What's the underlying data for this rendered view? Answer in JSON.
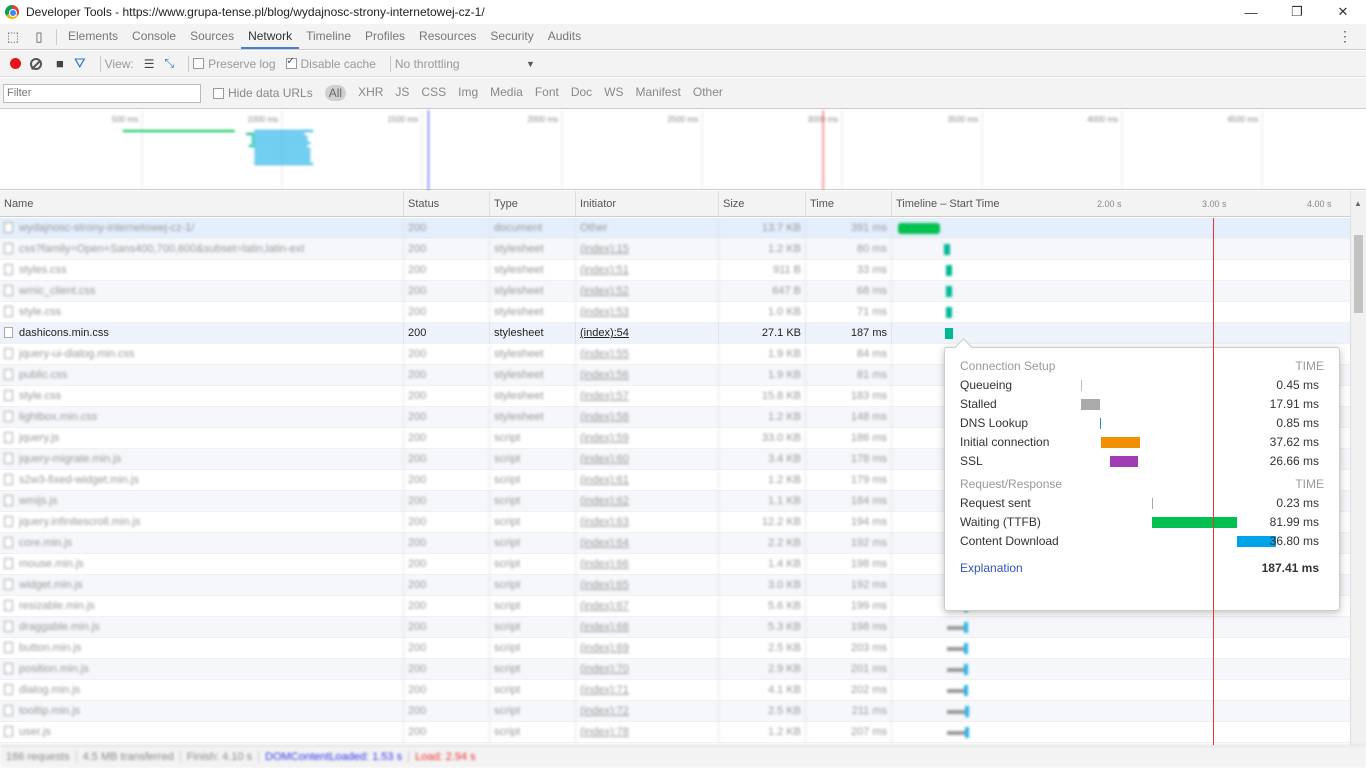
{
  "window": {
    "title": "Developer Tools - https://www.grupa-tense.pl/blog/wydajnosc-strony-internetowej-cz-1/",
    "minimize": "—",
    "restore": "❐",
    "close": "✕"
  },
  "tabs": [
    "Elements",
    "Console",
    "Sources",
    "Network",
    "Timeline",
    "Profiles",
    "Resources",
    "Security",
    "Audits"
  ],
  "active_tab": "Network",
  "toolbar": {
    "view_label": "View:",
    "preserve_log": "Preserve log",
    "disable_cache": "Disable cache",
    "throttling": "No throttling"
  },
  "filter": {
    "placeholder": "Filter",
    "hide_data_urls": "Hide data URLs",
    "types": [
      "All",
      "XHR",
      "JS",
      "CSS",
      "Img",
      "Media",
      "Font",
      "Doc",
      "WS",
      "Manifest",
      "Other"
    ]
  },
  "overview_ticks": [
    "500 ms",
    "1000 ms",
    "1500 ms",
    "2000 ms",
    "2500 ms",
    "3000 ms",
    "3500 ms",
    "4000 ms",
    "4500 ms"
  ],
  "columns": {
    "name": "Name",
    "status": "Status",
    "type": "Type",
    "initiator": "Initiator",
    "size": "Size",
    "time": "Time",
    "timeline": "Timeline – Start Time",
    "t1": "2.00 s",
    "t2": "3.00 s",
    "t3": "4.00 s"
  },
  "rows": [
    {
      "name": "wydajnosc-strony-internetowej-cz-1/",
      "status": "200",
      "type": "document",
      "initiator": "Other",
      "size": "13.7 KB",
      "time": "391 ms",
      "start": 0.01,
      "dur": 0.4
    },
    {
      "name": "css?family=Open+Sans400,700,600&subset=latin,latin-ext",
      "status": "200",
      "type": "stylesheet",
      "initiator": "(index):15",
      "size": "1.2 KB",
      "time": "80 ms",
      "start": 0.45,
      "dur": 0.08
    },
    {
      "name": "styles.css",
      "status": "200",
      "type": "stylesheet",
      "initiator": "(index):51",
      "size": "911 B",
      "time": "33 ms",
      "start": 0.47,
      "dur": 0.04
    },
    {
      "name": "wmic_client.css",
      "status": "200",
      "type": "stylesheet",
      "initiator": "(index):52",
      "size": "647 B",
      "time": "68 ms",
      "start": 0.47,
      "dur": 0.05
    },
    {
      "name": "style.css",
      "status": "200",
      "type": "stylesheet",
      "initiator": "(index):53",
      "size": "1.0 KB",
      "time": "71 ms",
      "start": 0.47,
      "dur": 0.05
    },
    {
      "name": "dashicons.min.css",
      "status": "200",
      "type": "stylesheet",
      "initiator": "(index):54",
      "size": "27.1 KB",
      "time": "187 ms",
      "start": 0.46,
      "dur": 0.19
    },
    {
      "name": "jquery-ui-dialog.min.css",
      "status": "200",
      "type": "stylesheet",
      "initiator": "(index):55",
      "size": "1.9 KB",
      "time": "84 ms",
      "start": 0.48,
      "dur": 0.08
    },
    {
      "name": "public.css",
      "status": "200",
      "type": "stylesheet",
      "initiator": "(index):56",
      "size": "1.9 KB",
      "time": "81 ms",
      "start": 0.48,
      "dur": 0.08
    },
    {
      "name": "style.css",
      "status": "200",
      "type": "stylesheet",
      "initiator": "(index):57",
      "size": "15.8 KB",
      "time": "183 ms",
      "start": 0.48,
      "dur": 0.18
    },
    {
      "name": "lightbox.min.css",
      "status": "200",
      "type": "stylesheet",
      "initiator": "(index):58",
      "size": "1.2 KB",
      "time": "148 ms",
      "start": 0.48,
      "dur": 0.15
    },
    {
      "name": "jquery.js",
      "status": "200",
      "type": "script",
      "initiator": "(index):59",
      "size": "33.0 KB",
      "time": "186 ms",
      "start": 0.48,
      "dur": 0.19
    },
    {
      "name": "jquery-migrate.min.js",
      "status": "200",
      "type": "script",
      "initiator": "(index):60",
      "size": "3.4 KB",
      "time": "178 ms",
      "start": 0.48,
      "dur": 0.18
    },
    {
      "name": "s2w3-fixed-widget.min.js",
      "status": "200",
      "type": "script",
      "initiator": "(index):61",
      "size": "1.2 KB",
      "time": "179 ms",
      "start": 0.48,
      "dur": 0.18
    },
    {
      "name": "wmijs.js",
      "status": "200",
      "type": "script",
      "initiator": "(index):62",
      "size": "1.1 KB",
      "time": "184 ms",
      "start": 0.48,
      "dur": 0.18
    },
    {
      "name": "jquery.infinitescroll.min.js",
      "status": "200",
      "type": "script",
      "initiator": "(index):63",
      "size": "12.2 KB",
      "time": "194 ms",
      "start": 0.48,
      "dur": 0.19
    },
    {
      "name": "core.min.js",
      "status": "200",
      "type": "script",
      "initiator": "(index):64",
      "size": "2.2 KB",
      "time": "192 ms",
      "start": 0.48,
      "dur": 0.19
    },
    {
      "name": "mouse.min.js",
      "status": "200",
      "type": "script",
      "initiator": "(index):66",
      "size": "1.4 KB",
      "time": "198 ms",
      "start": 0.48,
      "dur": 0.2
    },
    {
      "name": "widget.min.js",
      "status": "200",
      "type": "script",
      "initiator": "(index):65",
      "size": "3.0 KB",
      "time": "192 ms",
      "start": 0.48,
      "dur": 0.19
    },
    {
      "name": "resizable.min.js",
      "status": "200",
      "type": "script",
      "initiator": "(index):67",
      "size": "5.6 KB",
      "time": "199 ms",
      "start": 0.48,
      "dur": 0.2
    },
    {
      "name": "draggable.min.js",
      "status": "200",
      "type": "script",
      "initiator": "(index):68",
      "size": "5.3 KB",
      "time": "198 ms",
      "start": 0.48,
      "dur": 0.2
    },
    {
      "name": "button.min.js",
      "status": "200",
      "type": "script",
      "initiator": "(index):69",
      "size": "2.5 KB",
      "time": "203 ms",
      "start": 0.48,
      "dur": 0.2
    },
    {
      "name": "position.min.js",
      "status": "200",
      "type": "script",
      "initiator": "(index):70",
      "size": "2.9 KB",
      "time": "201 ms",
      "start": 0.48,
      "dur": 0.2
    },
    {
      "name": "dialog.min.js",
      "status": "200",
      "type": "script",
      "initiator": "(index):71",
      "size": "4.1 KB",
      "time": "202 ms",
      "start": 0.48,
      "dur": 0.2
    },
    {
      "name": "tooltip.min.js",
      "status": "200",
      "type": "script",
      "initiator": "(index):72",
      "size": "2.5 KB",
      "time": "211 ms",
      "start": 0.48,
      "dur": 0.21
    },
    {
      "name": "user.js",
      "status": "200",
      "type": "script",
      "initiator": "(index):78",
      "size": "1.2 KB",
      "time": "207 ms",
      "start": 0.48,
      "dur": 0.21
    }
  ],
  "timeline_scale_seconds": 4.4,
  "dom_content_loaded_s": 1.53,
  "load_s": 2.94,
  "tooltip": {
    "setup_header": "Connection Setup",
    "time_header": "TIME",
    "setup": [
      {
        "label": "Queueing",
        "value": "0.45 ms",
        "start": 0.0,
        "dur": 0.45,
        "color": "#bbbbbb"
      },
      {
        "label": "Stalled",
        "value": "17.91 ms",
        "start": 0.45,
        "dur": 17.91,
        "color": "#aaaaaa"
      },
      {
        "label": "DNS Lookup",
        "value": "0.85 ms",
        "start": 18.36,
        "dur": 0.85,
        "color": "#1f8ad6"
      },
      {
        "label": "Initial connection",
        "value": "37.62 ms",
        "start": 19.21,
        "dur": 37.62,
        "color": "#f29100"
      },
      {
        "label": "SSL",
        "value": "26.66 ms",
        "start": 28.0,
        "dur": 26.66,
        "color": "#a03cb4"
      }
    ],
    "req_header": "Request/Response",
    "req": [
      {
        "label": "Request sent",
        "value": "0.23 ms",
        "start": 68.12,
        "dur": 0.23,
        "color": "#aaaaaa"
      },
      {
        "label": "Waiting (TTFB)",
        "value": "81.99 ms",
        "start": 68.35,
        "dur": 81.99,
        "color": "#00c050"
      },
      {
        "label": "Content Download",
        "value": "36.80 ms",
        "start": 150.34,
        "dur": 36.8,
        "color": "#00a2e8"
      }
    ],
    "explanation": "Explanation",
    "total": "187.41 ms",
    "total_ms": 187.41
  },
  "status": {
    "requests": "186 requests",
    "transferred": "4.5 MB transferred",
    "finish": "Finish: 4.10 s",
    "dcl": "DOMContentLoaded: 1.53 s",
    "load": "Load: 2.94 s"
  },
  "colors": {
    "dcl": "#3333ee",
    "load": "#ee3333",
    "doc": "#00c050",
    "css": "#00b894",
    "js": "#2bb5e8"
  }
}
